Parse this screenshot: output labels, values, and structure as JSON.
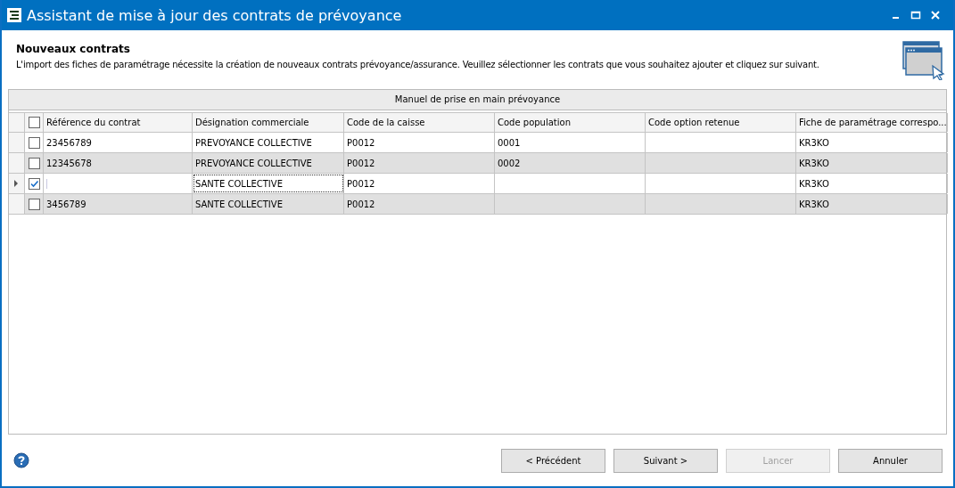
{
  "window": {
    "title": "Assistant de mise à jour des contrats de prévoyance"
  },
  "header": {
    "title": "Nouveaux contrats",
    "description": "L'import des fiches de paramétrage nécessite la création de nouveaux contrats prévoyance/assurance. Veuillez sélectionner les contrats que vous souhaitez ajouter et cliquez sur suivant."
  },
  "manual_link": "Manuel de prise en main prévoyance",
  "table": {
    "select_all": {
      "checked": false
    },
    "columns": [
      "Référence du contrat",
      "Désignation commerciale",
      "Code de la caisse",
      "Code population",
      "Code option retenue",
      "Fiche de paramétrage correspo..."
    ],
    "rows": [
      {
        "checked": false,
        "current": false,
        "cells": [
          "23456789",
          "PREVOYANCE COLLECTIVE",
          "P0012",
          "0001",
          "",
          "KR3KO"
        ]
      },
      {
        "checked": false,
        "current": false,
        "cells": [
          "12345678",
          "PREVOYANCE COLLECTIVE",
          "P0012",
          "0002",
          "",
          "KR3KO"
        ]
      },
      {
        "checked": true,
        "current": true,
        "cells": [
          "",
          "SANTE COLLECTIVE",
          "P0012",
          "",
          "",
          "KR3KO"
        ]
      },
      {
        "checked": false,
        "current": false,
        "cells": [
          "3456789",
          "SANTE COLLECTIVE",
          "P0012",
          "",
          "",
          "KR3KO"
        ]
      }
    ]
  },
  "buttons": [
    {
      "label": "< Précédent",
      "disabled": false
    },
    {
      "label": "Suivant >",
      "disabled": false
    },
    {
      "label": "Lancer",
      "disabled": true
    },
    {
      "label": "Annuler",
      "disabled": false
    }
  ]
}
